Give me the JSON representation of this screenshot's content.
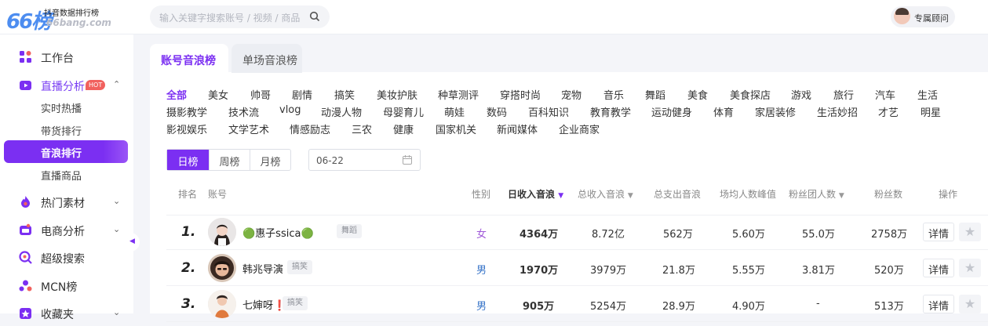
{
  "logo": {
    "mark": "66榜",
    "title": "抖音数据排行榜",
    "domain": "66bang.com"
  },
  "search": {
    "placeholder": "输入关键字搜索账号 / 视频 / 商品"
  },
  "consultant": {
    "label": "专属顾问"
  },
  "sidebar": {
    "items": [
      {
        "label": "工作台",
        "icon": "workbench-icon"
      },
      {
        "label": "直播分析",
        "icon": "live-icon",
        "badge": "HOT",
        "arrow": "⌃"
      },
      {
        "label": "热门素材",
        "icon": "fire-icon",
        "arrow": "⌄"
      },
      {
        "label": "电商分析",
        "icon": "shop-icon",
        "arrow": "⌄"
      },
      {
        "label": "超级搜索",
        "icon": "search-icon"
      },
      {
        "label": "MCN榜",
        "icon": "mcn-icon"
      },
      {
        "label": "收藏夹",
        "icon": "star-icon",
        "arrow": "⌄"
      }
    ],
    "live_sub": [
      "实时热播",
      "带货排行",
      "音浪排行",
      "直播商品"
    ],
    "active_sub": "音浪排行"
  },
  "tabs": [
    "账号音浪榜",
    "单场音浪榜"
  ],
  "categories": [
    [
      "全部",
      "美女",
      "帅哥",
      "剧情",
      "搞笑",
      "美妆护肤",
      "种草测评",
      "穿搭时尚",
      "宠物",
      "音乐",
      "舞蹈",
      "美食",
      "美食探店",
      "游戏",
      "旅行",
      "汽车",
      "生活"
    ],
    [
      "摄影教学",
      "技术流",
      "vlog",
      "动漫人物",
      "母婴育儿",
      "萌娃",
      "数码",
      "百科知识",
      "教育教学",
      "运动健身",
      "体育",
      "家居装修",
      "生活妙招",
      "才艺",
      "明星"
    ],
    [
      "影视娱乐",
      "文学艺术",
      "情感励志",
      "三农",
      "健康",
      "国家机关",
      "新闻媒体",
      "企业商家"
    ]
  ],
  "periods": [
    "日榜",
    "周榜",
    "月榜"
  ],
  "date": "06-22",
  "columns": [
    "排名",
    "账号",
    "性别",
    "日收入音浪",
    "总收入音浪",
    "总支出音浪",
    "场均人数峰值",
    "粉丝团人数",
    "粉丝数",
    "操作"
  ],
  "rows": [
    {
      "rank": "1.",
      "name": "🟢惠子ssica🟢",
      "tag": "舞蹈",
      "gender": "女",
      "daily": "4364万",
      "total_in": "8.72亿",
      "total_out": "562万",
      "avg_peak": "5.60万",
      "fan_club": "55.0万",
      "fans": "2758万",
      "action": "详情"
    },
    {
      "rank": "2.",
      "name": "韩兆导演",
      "tag": "搞笑",
      "gender": "男",
      "daily": "1970万",
      "total_in": "3979万",
      "total_out": "21.8万",
      "avg_peak": "5.55万",
      "fan_club": "3.81万",
      "fans": "520万",
      "action": "详情"
    },
    {
      "rank": "3.",
      "name": "七婶呀❗",
      "tag": "搞笑",
      "gender": "男",
      "daily": "905万",
      "total_in": "5254万",
      "total_out": "28.9万",
      "avg_peak": "4.90万",
      "fan_club": "-",
      "fans": "513万",
      "action": "详情"
    }
  ],
  "colors": {
    "accent": "#7b2ff2",
    "female": "#a05ad8",
    "male": "#3a76c9",
    "hot": "#f1615e"
  }
}
